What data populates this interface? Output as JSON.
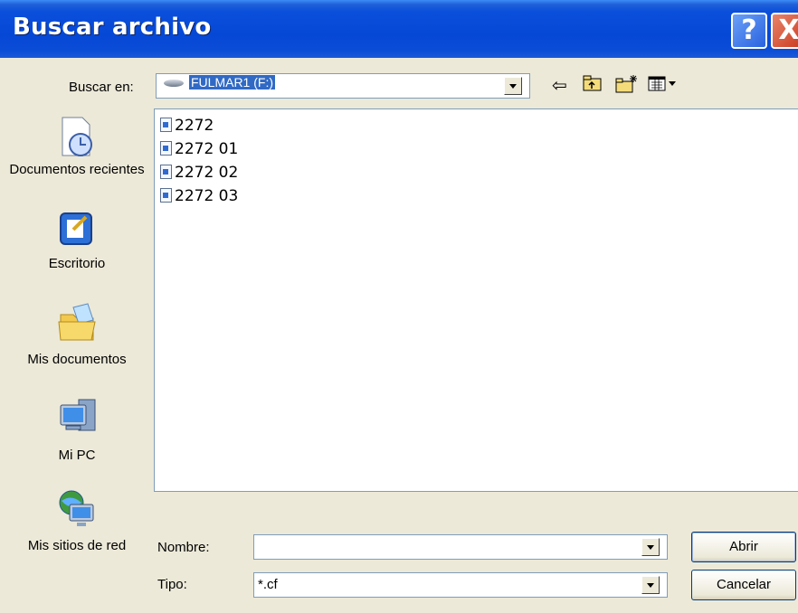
{
  "window": {
    "title": "Buscar archivo"
  },
  "titlebar_buttons": {
    "help": "?",
    "close": "X"
  },
  "look_in": {
    "label": "Buscar en:",
    "value": "FULMAR1 (F:)"
  },
  "toolbar_icons": [
    "back-arrow-icon",
    "up-folder-icon",
    "new-folder-icon",
    "view-menu-icon"
  ],
  "places": [
    {
      "label": "Documentos recientes",
      "icon": "recent-documents-icon"
    },
    {
      "label": "Escritorio",
      "icon": "desktop-icon"
    },
    {
      "label": "Mis documentos",
      "icon": "my-documents-icon"
    },
    {
      "label": "Mi PC",
      "icon": "my-computer-icon"
    },
    {
      "label": "Mis sitios de red",
      "icon": "network-places-icon"
    }
  ],
  "files": [
    "2272",
    "2272 01",
    "2272 02",
    "2272 03"
  ],
  "filename": {
    "label": "Nombre:",
    "value": ""
  },
  "filetype": {
    "label": "Tipo:",
    "value": "*.cf"
  },
  "buttons": {
    "open": "Abrir",
    "cancel": "Cancelar"
  }
}
